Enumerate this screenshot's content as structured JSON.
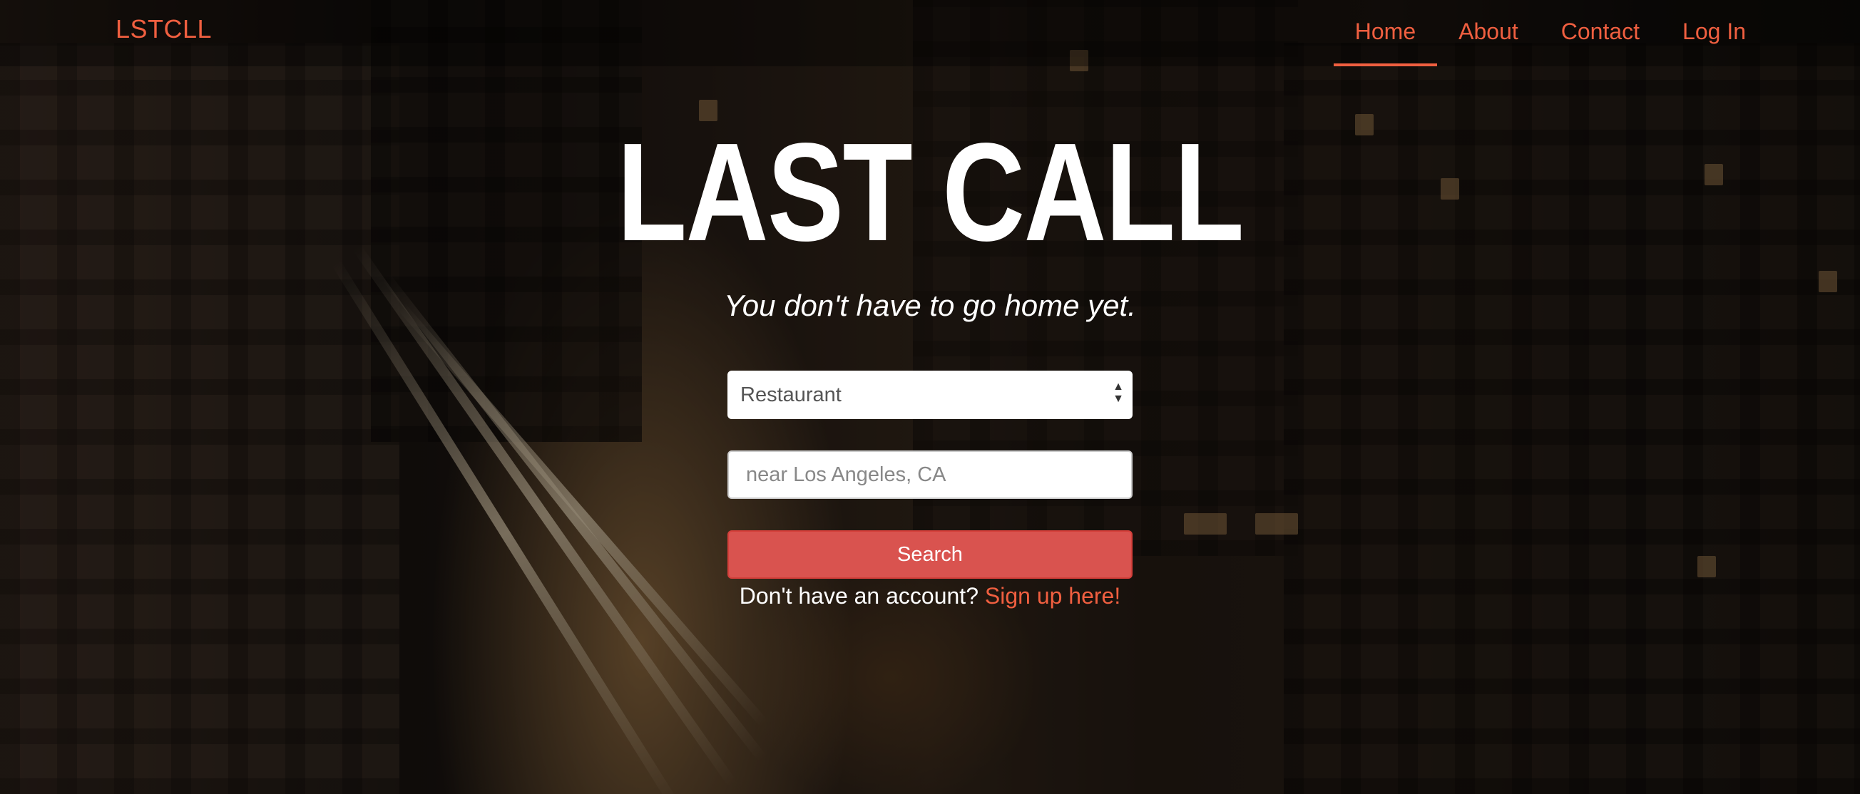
{
  "navbar": {
    "brand": "LSTCLL",
    "items": [
      {
        "label": "Home",
        "active": true
      },
      {
        "label": "About"
      },
      {
        "label": "Contact"
      },
      {
        "label": "Log In"
      }
    ]
  },
  "hero": {
    "title": "LAST CALL",
    "tagline": "You don't have to go home yet."
  },
  "search_form": {
    "category_selected": "Restaurant",
    "location_placeholder": "near Los Angeles, CA",
    "search_button": "Search"
  },
  "signup": {
    "prompt": "Don't have an account?",
    "link": "Sign up here!"
  },
  "colors": {
    "accent": "#f05f40",
    "button": "#d9534f",
    "text": "#ffffff"
  }
}
